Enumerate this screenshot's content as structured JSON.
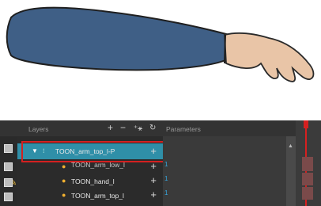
{
  "layers_panel": {
    "header_label": "Layers",
    "params_header_label": "Parameters",
    "toolbar": {
      "add_label": "+",
      "remove_label": "−",
      "add_peg_icon": "add-peg-icon",
      "effect_icon": "effect-icon"
    },
    "rows": [
      {
        "name": "TOON_arm_top_l-P",
        "type": "peg",
        "selected": true,
        "expanded": true,
        "plus": "+",
        "param": ""
      },
      {
        "name": "TOON_arm_low_l",
        "type": "drawing",
        "selected": false,
        "plus": "+",
        "param": "1"
      },
      {
        "name": "TOON_hand_l",
        "type": "drawing",
        "selected": false,
        "plus": "+",
        "param": "1"
      },
      {
        "name": "TOON_arm_top_l",
        "type": "drawing",
        "selected": false,
        "plus": "+",
        "param": "1"
      }
    ]
  },
  "colors": {
    "selection": "#2f8fa8",
    "highlight_box": "#d32020",
    "sleeve": "#3f5f86",
    "skin": "#e9c5a7",
    "playhead": "#d62020"
  }
}
